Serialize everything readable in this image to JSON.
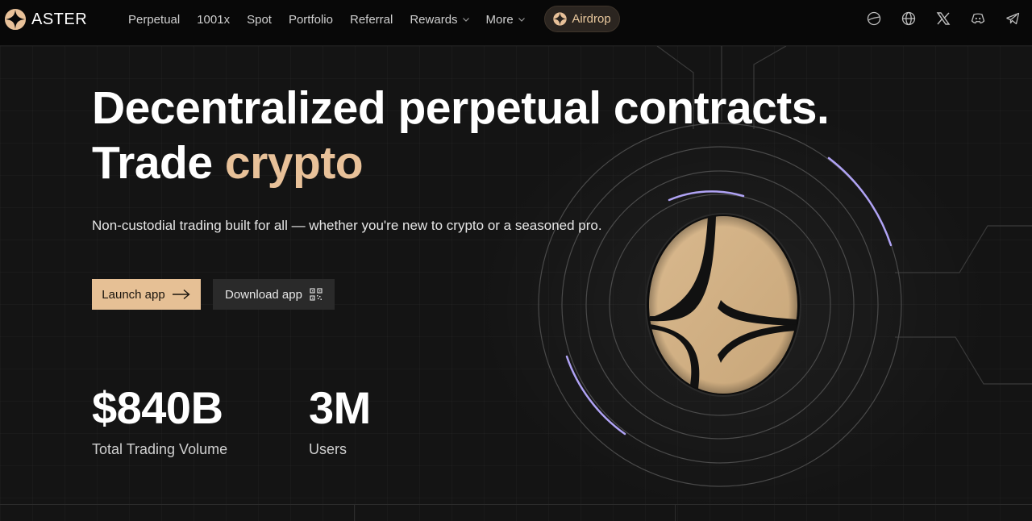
{
  "brand": {
    "name": "ASTER"
  },
  "nav": {
    "items": [
      {
        "label": "Perpetual"
      },
      {
        "label": "1001x"
      },
      {
        "label": "Spot"
      },
      {
        "label": "Portfolio"
      },
      {
        "label": "Referral"
      },
      {
        "label": "Rewards"
      },
      {
        "label": "More"
      }
    ],
    "airdrop_label": "Airdrop"
  },
  "header_icons": [
    "theme-icon",
    "globe-icon",
    "x-icon",
    "discord-icon",
    "telegram-icon"
  ],
  "hero": {
    "title_line1": "Decentralized perpetual contracts.",
    "title_line2_prefix": "Trade",
    "title_line2_accent": "crypto",
    "subtitle": "Non-custodial trading built for all — whether you're new to crypto or a seasoned pro.",
    "launch_label": "Launch app",
    "download_label": "Download app"
  },
  "stats": [
    {
      "value": "$840B",
      "label": "Total Trading Volume"
    },
    {
      "value": "3M",
      "label": "Users"
    }
  ],
  "colors": {
    "accent": "#e8c199",
    "background": "#141414",
    "ring_highlight": "#a99af0"
  }
}
